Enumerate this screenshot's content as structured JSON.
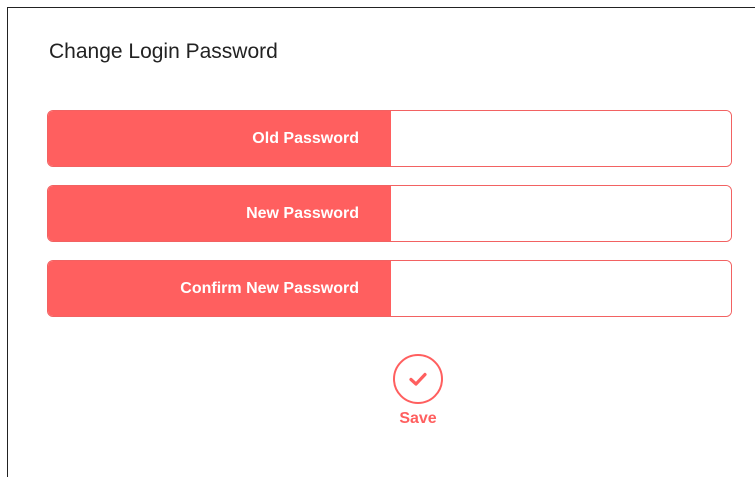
{
  "page": {
    "title": "Change Login Password"
  },
  "form": {
    "fields": [
      {
        "label": "Old Password",
        "value": ""
      },
      {
        "label": "New Password",
        "value": ""
      },
      {
        "label": "Confirm New Password",
        "value": ""
      }
    ]
  },
  "actions": {
    "save_label": "Save",
    "save_icon": "check-icon"
  },
  "colors": {
    "accent": "#ff5f5f",
    "border": "#f26262",
    "text_dark": "#222222",
    "background": "#ffffff"
  }
}
